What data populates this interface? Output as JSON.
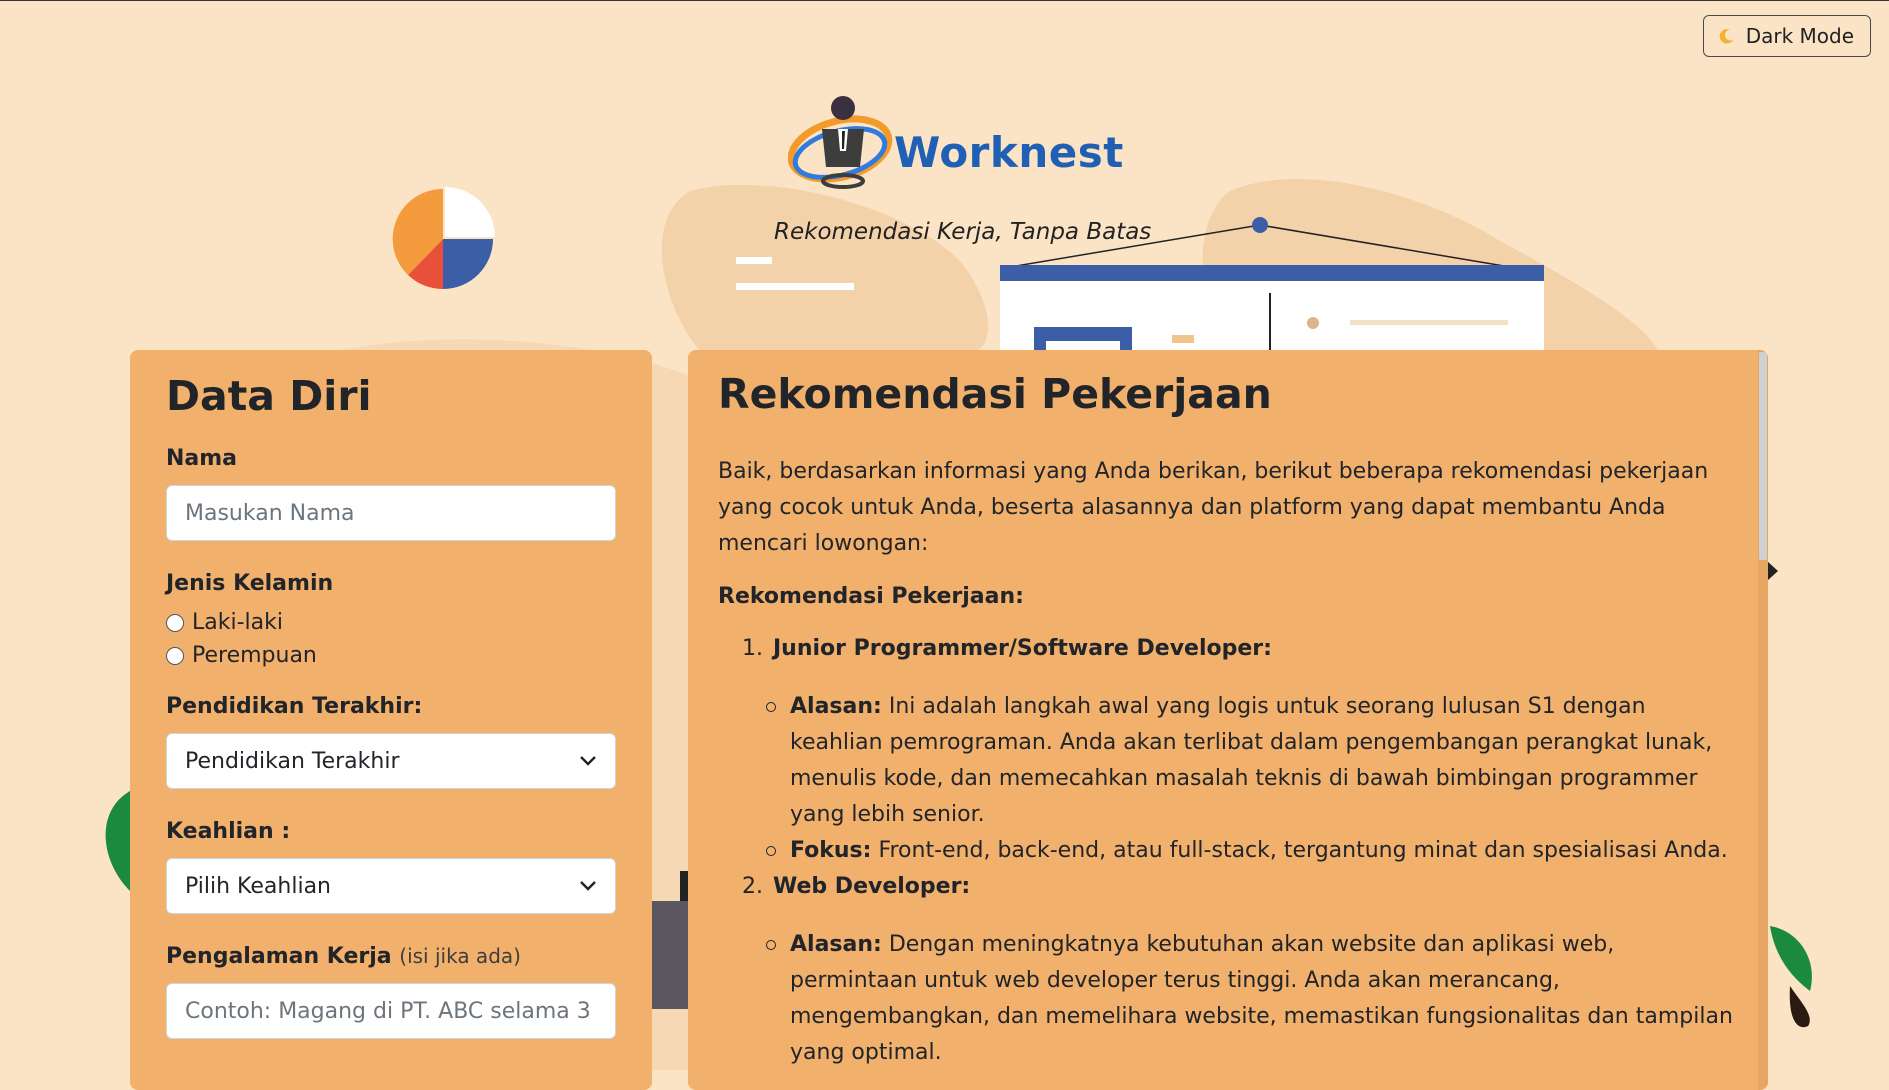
{
  "toggle": {
    "label": "Dark Mode",
    "icon": "moon-icon"
  },
  "brand": {
    "name": "Worknest",
    "tagline": "Rekomendasi Kerja, Tanpa Batas"
  },
  "form": {
    "title": "Data Diri",
    "name_label": "Nama",
    "name_placeholder": "Masukan Nama",
    "gender_label": "Jenis Kelamin",
    "gender_options": [
      "Laki-laki",
      "Perempuan"
    ],
    "education_label": "Pendidikan Terakhir:",
    "education_value": "Pendidikan Terakhir",
    "skill_label": "Keahlian :",
    "skill_value": "Pilih Keahlian",
    "experience_label": "Pengalaman Kerja",
    "experience_hint": "(isi jika ada)",
    "experience_placeholder": "Contoh: Magang di PT. ABC selama 3"
  },
  "result": {
    "title": "Rekomendasi Pekerjaan",
    "intro": "Baik, berdasarkan informasi yang Anda berikan, berikut beberapa rekomendasi pekerjaan yang cocok untuk Anda, beserta alasannya dan platform yang dapat membantu Anda mencari lowongan:",
    "subheading": "Rekomendasi Pekerjaan:",
    "jobs": [
      {
        "number": "1.",
        "title": "Junior Programmer/Software Developer:",
        "reason_label": "Alasan:",
        "reason": "Ini adalah langkah awal yang logis untuk seorang lulusan S1 dengan keahlian pemrograman. Anda akan terlibat dalam pengembangan perangkat lunak, menulis kode, dan memecahkan masalah teknis di bawah bimbingan programmer yang lebih senior.",
        "focus_label": "Fokus:",
        "focus": "Front-end, back-end, atau full-stack, tergantung minat dan spesialisasi Anda."
      },
      {
        "number": "2.",
        "title": "Web Developer:",
        "reason_label": "Alasan:",
        "reason": "Dengan meningkatnya kebutuhan akan website dan aplikasi web, permintaan untuk web developer terus tinggi. Anda akan merancang, mengembangkan, dan memelihara website, memastikan fungsionalitas dan tampilan yang optimal."
      }
    ]
  }
}
